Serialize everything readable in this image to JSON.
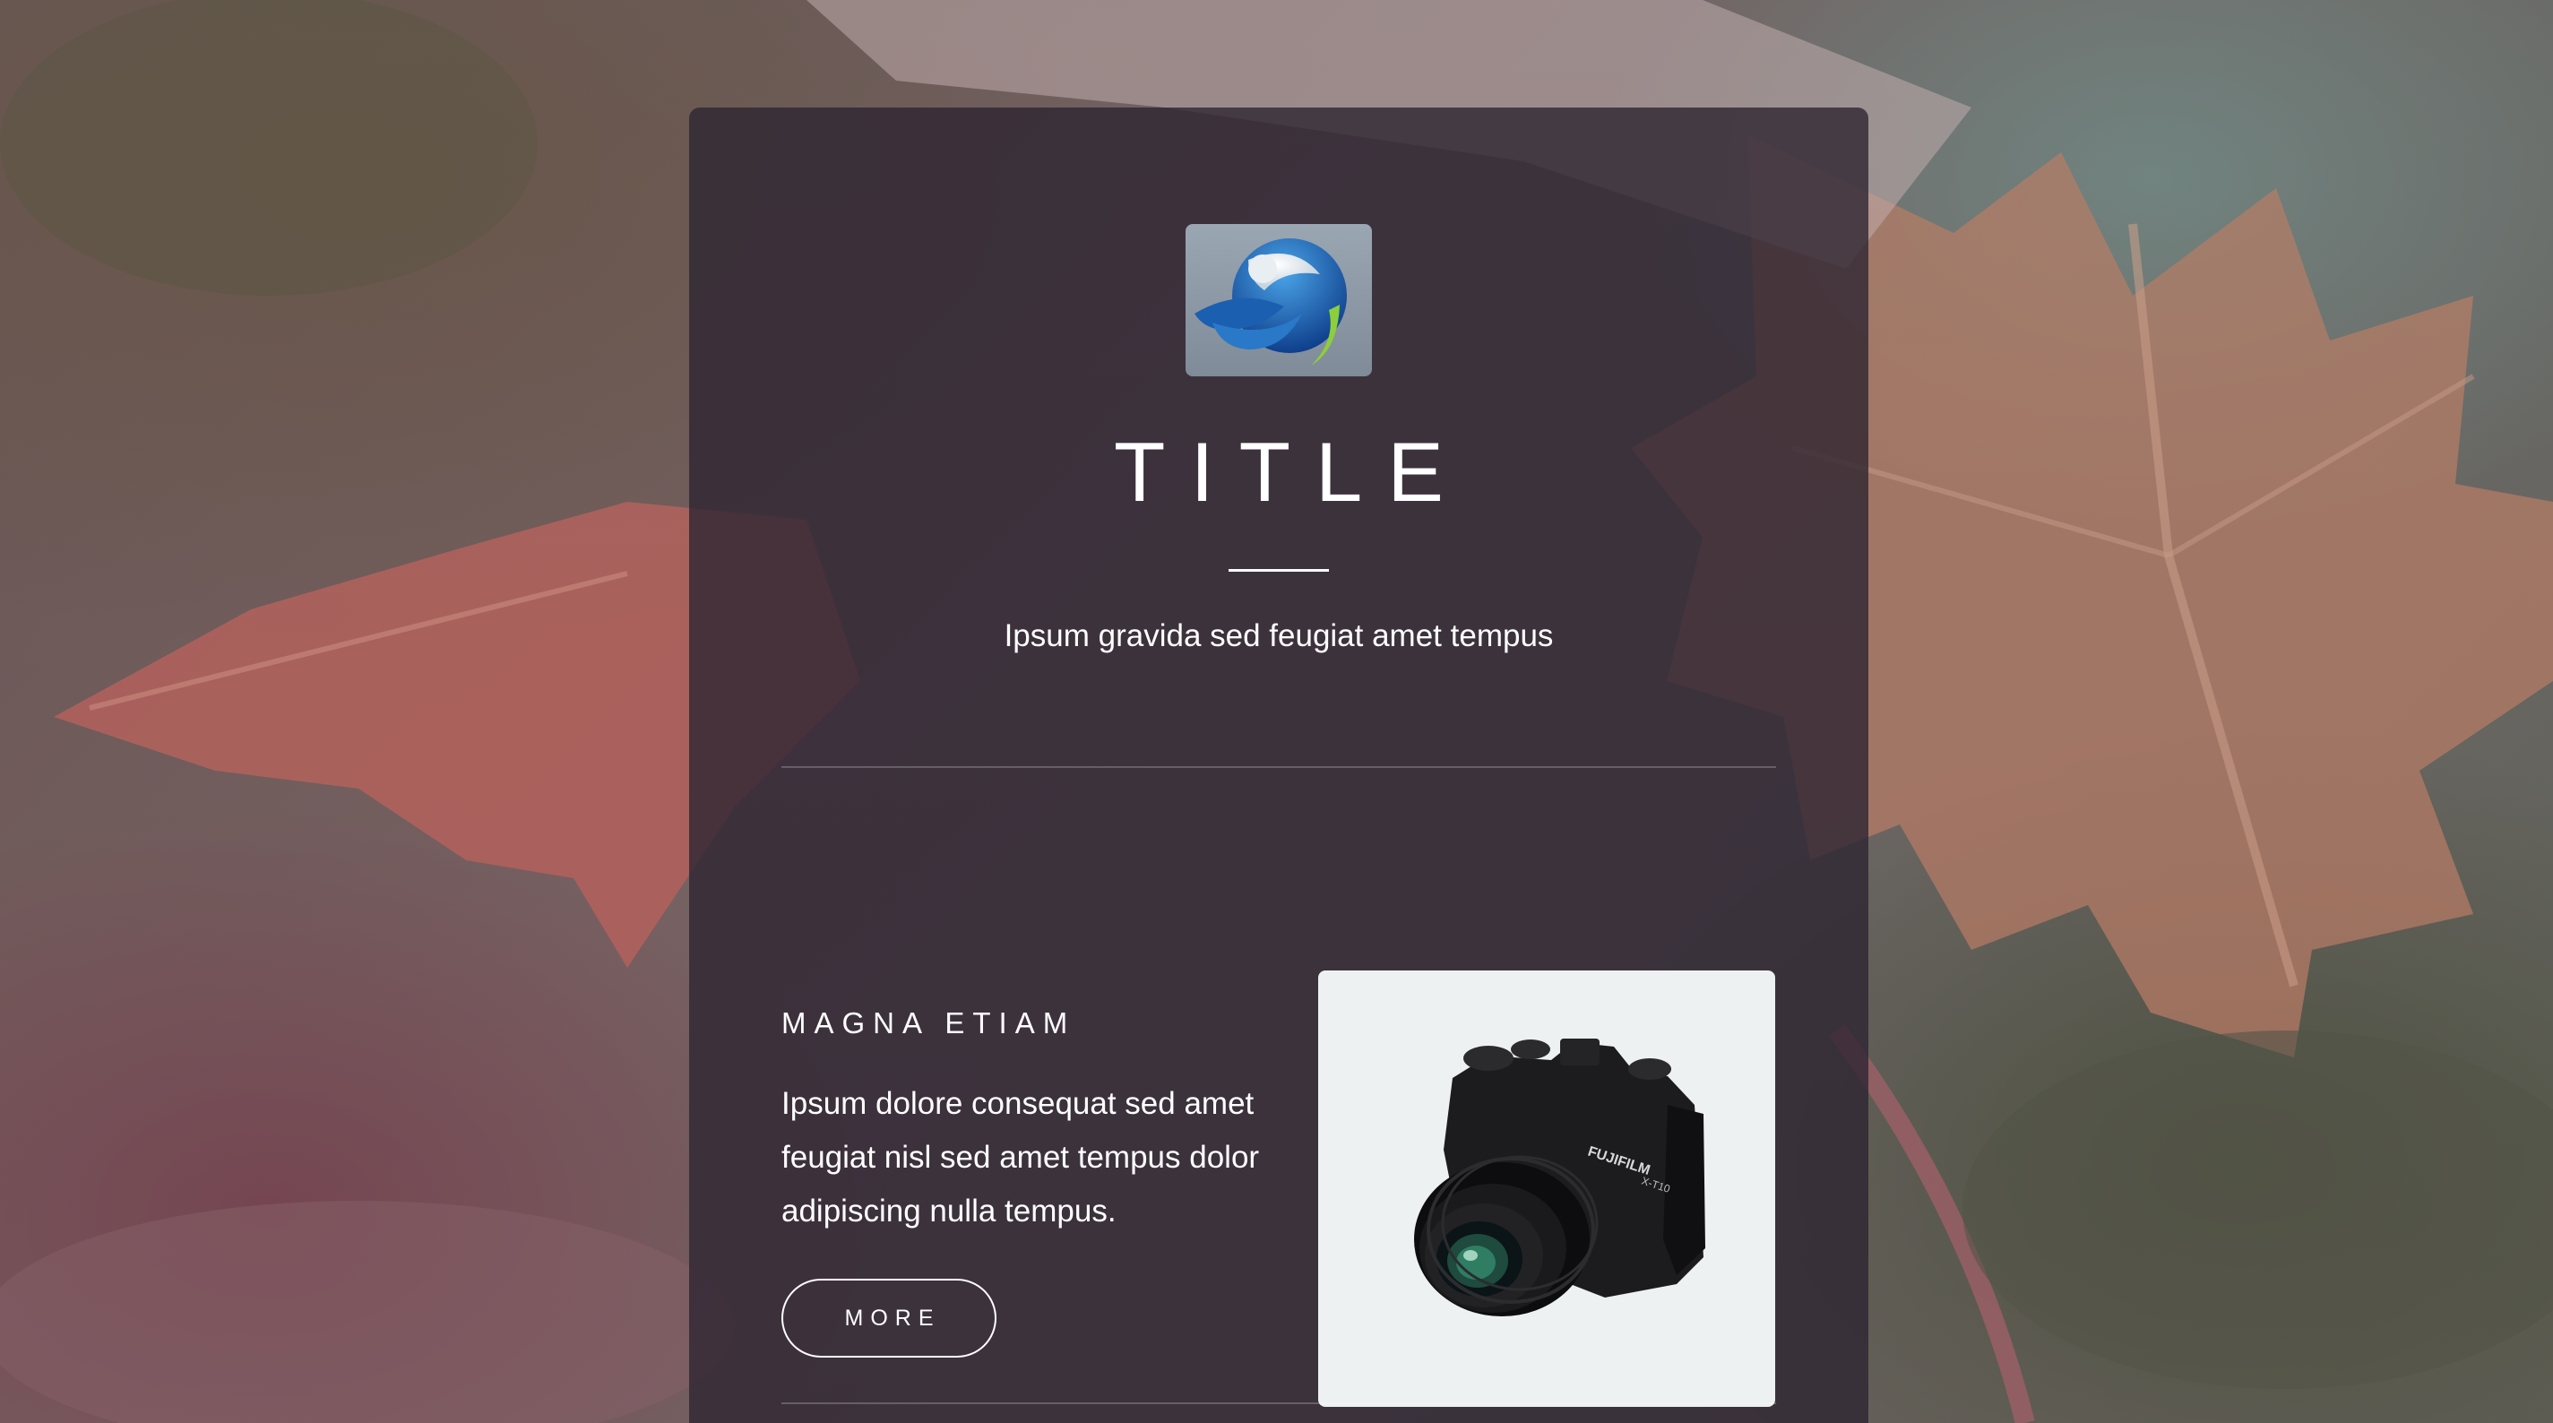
{
  "header": {
    "title": "TITLE",
    "subtitle": "Ipsum gravida sed feugiat amet tempus"
  },
  "feature": {
    "heading": "MAGNA ETIAM",
    "text": "Ipsum dolore consequat sed amet feugiat nisl sed amet tempus dolor adipiscing nulla tempus.",
    "button_label": "MORE",
    "image": "camera-photo",
    "camera_brand": "FUJIFILM",
    "camera_model": "X-T10"
  },
  "logo": {
    "icon": "blue-swirl-logo"
  },
  "background": {
    "image": "autumn-leaf-photo"
  }
}
